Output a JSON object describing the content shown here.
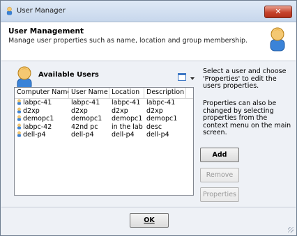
{
  "window": {
    "title": "User Manager",
    "close_label": "✕"
  },
  "header": {
    "title": "User Management",
    "subtitle": "Manage user properties such as name, location and group membership."
  },
  "users": {
    "label": "Available Users",
    "columns": [
      "Computer Name",
      "User Name",
      "Location",
      "Description"
    ],
    "rows": [
      {
        "computer": "labpc-41",
        "user": "labpc-41",
        "location": "labpc-41",
        "description": "labpc-41"
      },
      {
        "computer": "d2xp",
        "user": "d2xp",
        "location": "d2xp",
        "description": "d2xp"
      },
      {
        "computer": "demopc1",
        "user": "demopc1",
        "location": "demopc1",
        "description": "demopc1"
      },
      {
        "computer": "labpc-42",
        "user": "42nd pc",
        "location": "in the lab",
        "description": "desc"
      },
      {
        "computer": "dell-p4",
        "user": "dell-p4",
        "location": "dell-p4",
        "description": "dell-p4"
      }
    ]
  },
  "help": {
    "text1": "Select a user and choose 'Properties' to edit the users properties.",
    "text2": "Properties can also be changed by selecting properties from the context menu on the main screen."
  },
  "buttons": {
    "add": "Add",
    "remove": "Remove",
    "properties": "Properties",
    "ok": "OK"
  },
  "colors": {
    "avatar_head": "#f2b23a",
    "avatar_body": "#3a83d8",
    "close": "#c6432c"
  }
}
